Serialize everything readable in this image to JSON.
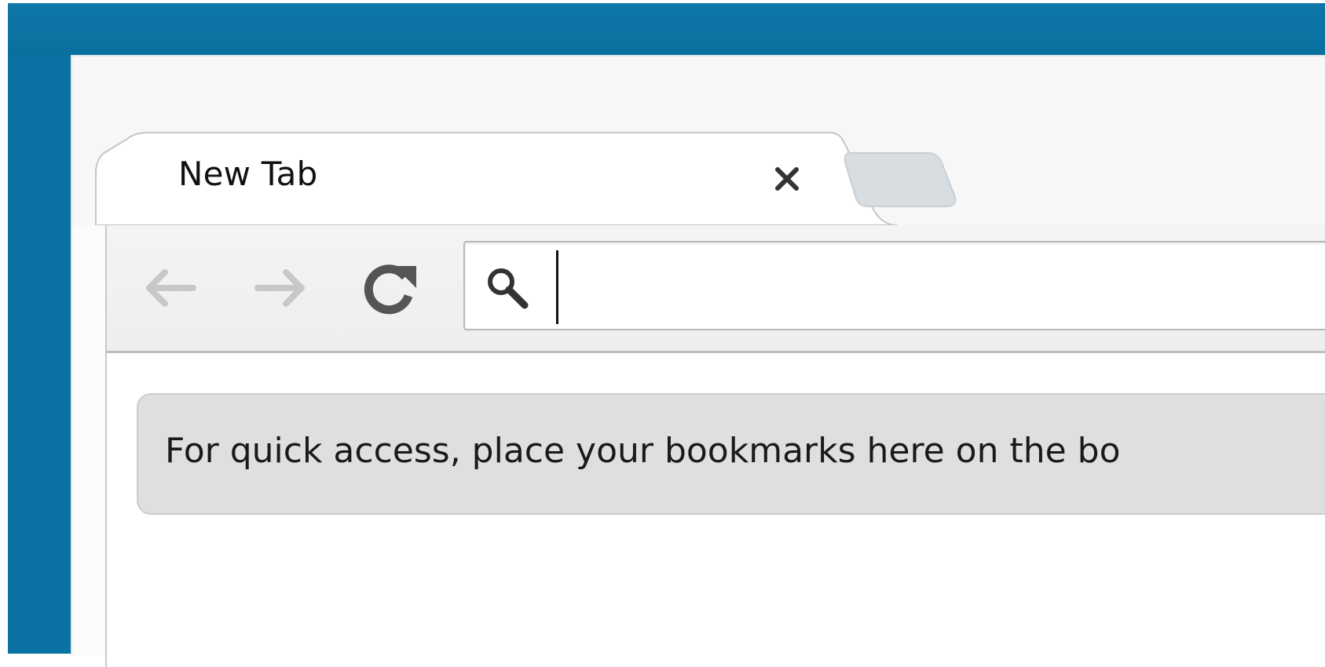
{
  "browser": {
    "tab": {
      "title": "New Tab",
      "close_icon": "close-icon"
    },
    "new_tab_icon": "new-tab-icon",
    "toolbar": {
      "back_icon": "back-arrow-icon",
      "forward_icon": "forward-arrow-icon",
      "reload_icon": "reload-icon"
    },
    "omnibox": {
      "search_icon": "search-icon",
      "value": "",
      "placeholder": ""
    }
  },
  "bookmark_bar": {
    "message": "For quick access, place your bookmarks here on the bo"
  },
  "colors": {
    "desktop": "#0a72a3",
    "bookmark_bar": "#dfdfdf",
    "disabled_arrow": "#c8c8c8",
    "reload": "#555555"
  }
}
